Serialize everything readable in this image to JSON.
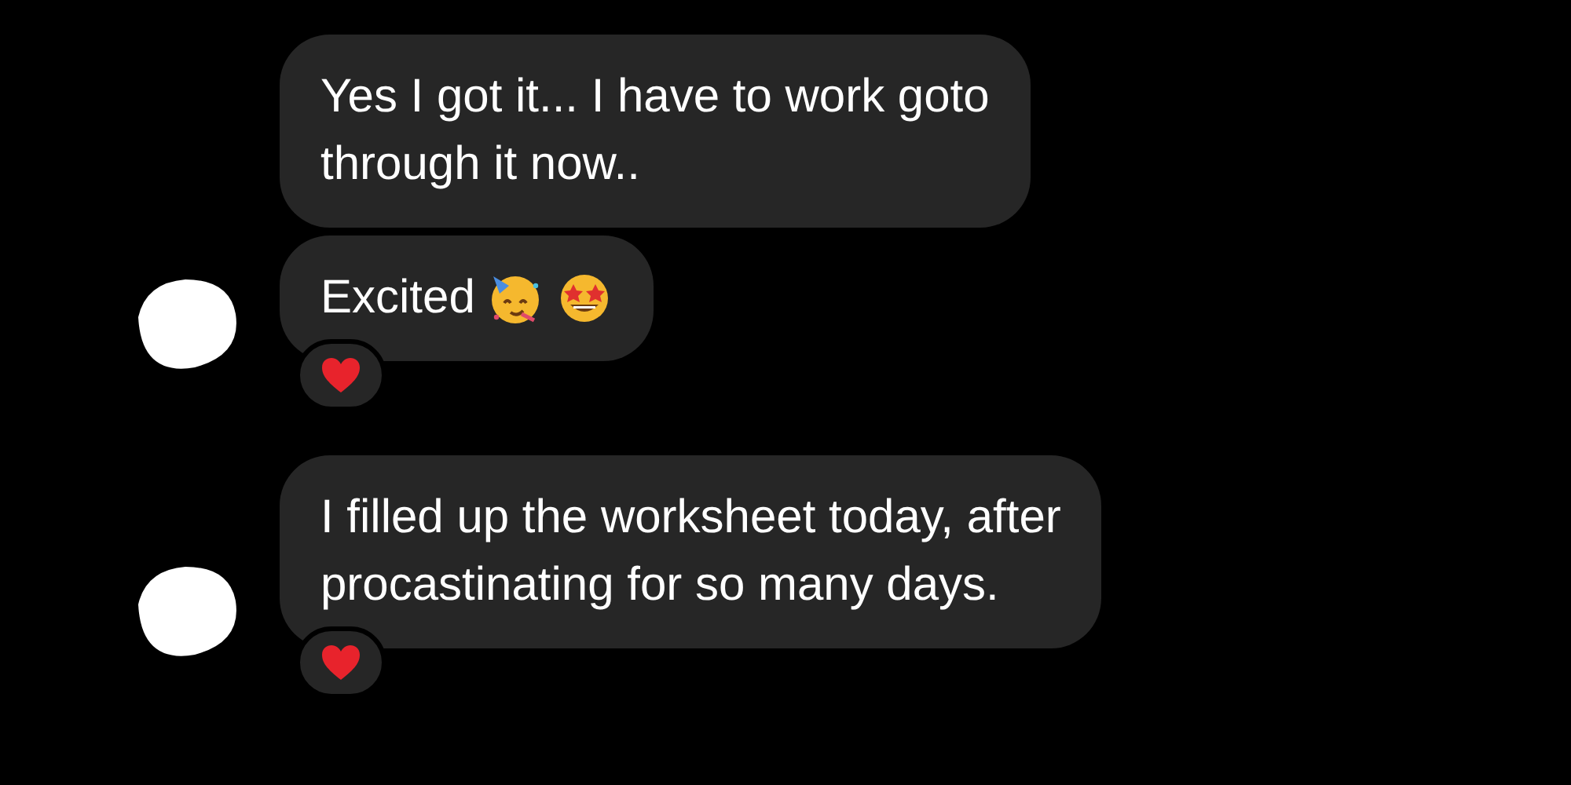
{
  "messages": [
    {
      "text": "Yes I got it... I have to work goto\nthrough it now..",
      "reacted": false,
      "avatar": false
    },
    {
      "text": "Excited",
      "emojis": [
        {
          "kind": "partying-face"
        },
        {
          "kind": "star-struck"
        }
      ],
      "reacted": true,
      "avatar": true
    },
    {
      "text": "I filled up the worksheet today, after\nprocastinating for so many days.",
      "reacted": true,
      "avatar": true
    }
  ]
}
